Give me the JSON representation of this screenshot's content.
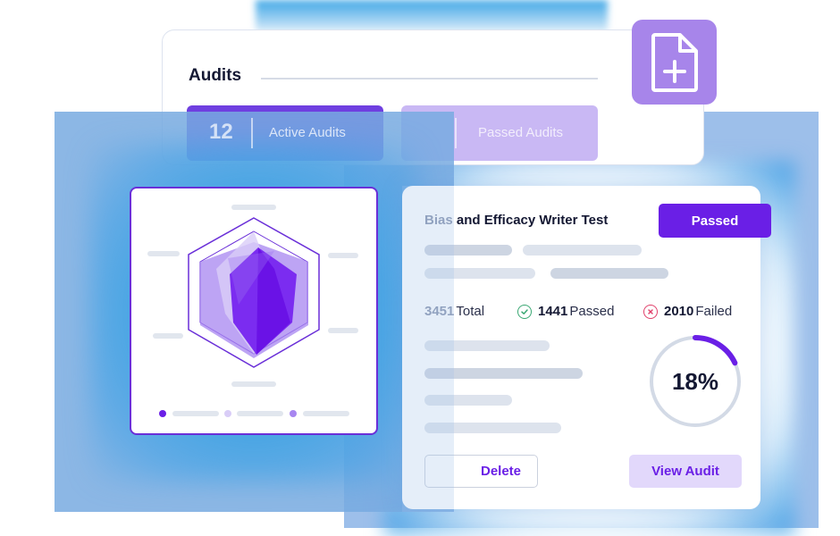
{
  "audits": {
    "title": "Audits",
    "active_count": "12",
    "active_label": "Active Audits",
    "passed_label": "Passed Audits"
  },
  "icons": {
    "add_document": "file-plus-icon",
    "passed_check": "check-circle-icon",
    "failed_x": "x-circle-icon"
  },
  "result": {
    "title_prefix": "Bias",
    "title_rest": " and Efficacy Writer Test",
    "status": "Passed",
    "total_value": "3451",
    "total_label": "Total",
    "passed_value": "1441",
    "passed_label": "Passed",
    "failed_value": "2010",
    "failed_label": "Failed",
    "percent": "18%",
    "progress_fraction": 0.18,
    "delete_label": "Delete",
    "view_label": "View Audit"
  },
  "colors": {
    "accent": "#6a1fe6",
    "accent_light": "#a785ea",
    "passed": "#3aa873",
    "failed": "#e0406a",
    "glow": "#3fa3e3"
  }
}
